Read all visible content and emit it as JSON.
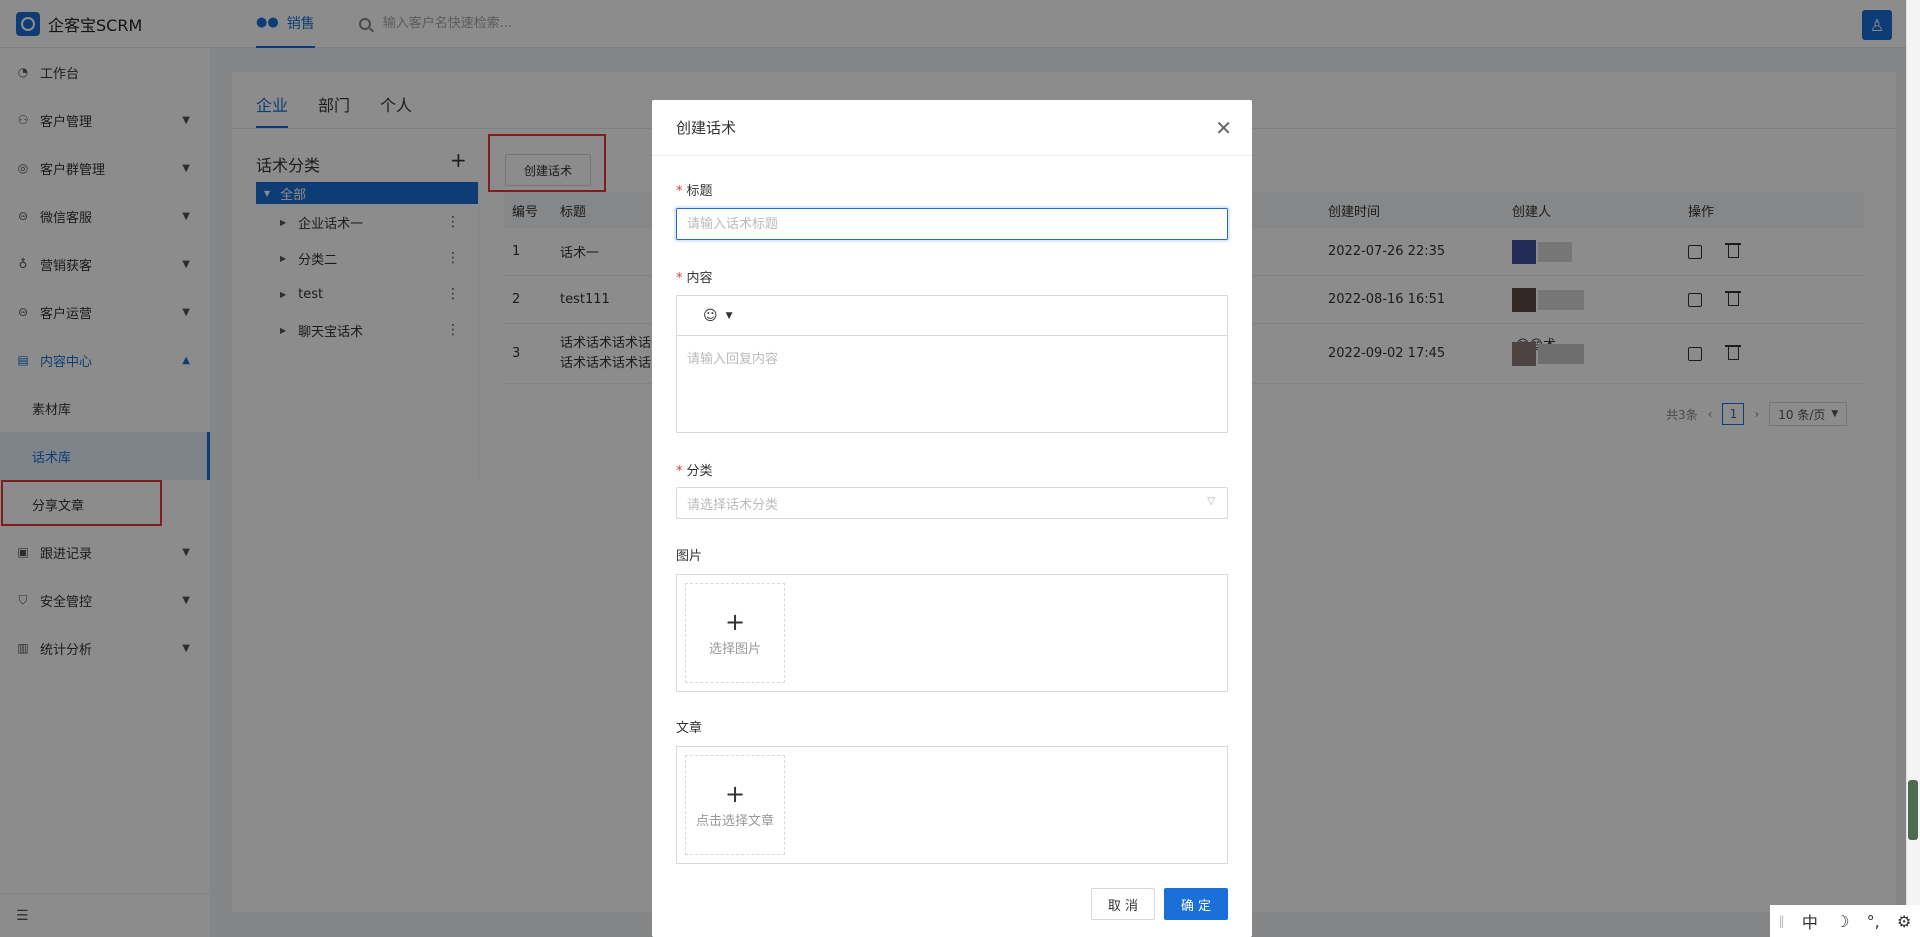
{
  "app": {
    "title": "企客宝SCRM"
  },
  "topnav": {
    "active": "销售",
    "search_placeholder": "输入客户名快速检索..."
  },
  "sidebar": {
    "items": [
      {
        "icon": "dashboard-icon",
        "label": "工作台"
      },
      {
        "icon": "customer-icon",
        "label": "客户管理"
      },
      {
        "icon": "group-chat-icon",
        "label": "客户群管理"
      },
      {
        "icon": "service-icon",
        "label": "微信客服"
      },
      {
        "icon": "marketing-icon",
        "label": "营销获客"
      },
      {
        "icon": "operation-icon",
        "label": "客户运营"
      },
      {
        "icon": "content-icon",
        "label": "内容中心"
      },
      {
        "icon": "record-icon",
        "label": "跟进记录"
      },
      {
        "icon": "shield-icon",
        "label": "安全管控"
      },
      {
        "icon": "chart-icon",
        "label": "统计分析"
      }
    ],
    "content_sub": [
      "素材库",
      "话术库",
      "分享文章"
    ]
  },
  "tabs": [
    "企业",
    "部门",
    "个人"
  ],
  "category": {
    "title": "话术分类",
    "all": "全部",
    "nodes": [
      "企业话术一",
      "分类二",
      "test",
      "聊天宝话术"
    ]
  },
  "create_button": "创建话术",
  "table": {
    "headers": {
      "no": "编号",
      "title": "标题",
      "time": "创建时间",
      "creator": "创建人",
      "op": "操作"
    },
    "rows": [
      {
        "no": "1",
        "title": "话术一",
        "time": "2022-07-26 22:35"
      },
      {
        "no": "2",
        "title": "test111",
        "time": "2022-08-16 16:51"
      },
      {
        "no": "3",
        "title": "话术话术话术话",
        "title2": "话术话术话术话",
        "content_tail": "😄😄术",
        "time": "2022-09-02 17:45"
      }
    ]
  },
  "pager": {
    "total": "共3条",
    "current": "1",
    "size": "10 条/页"
  },
  "modal": {
    "title": "创建话术",
    "title_label": "标题",
    "title_placeholder": "请输入话术标题",
    "content_label": "内容",
    "content_placeholder": "请输入回复内容",
    "category_label": "分类",
    "category_placeholder": "请选择话术分类",
    "image_label": "图片",
    "image_upload": "选择图片",
    "article_label": "文章",
    "article_upload": "点击选择文章",
    "cancel": "取 消",
    "ok": "确 定"
  },
  "ime": {
    "lang": "中"
  }
}
